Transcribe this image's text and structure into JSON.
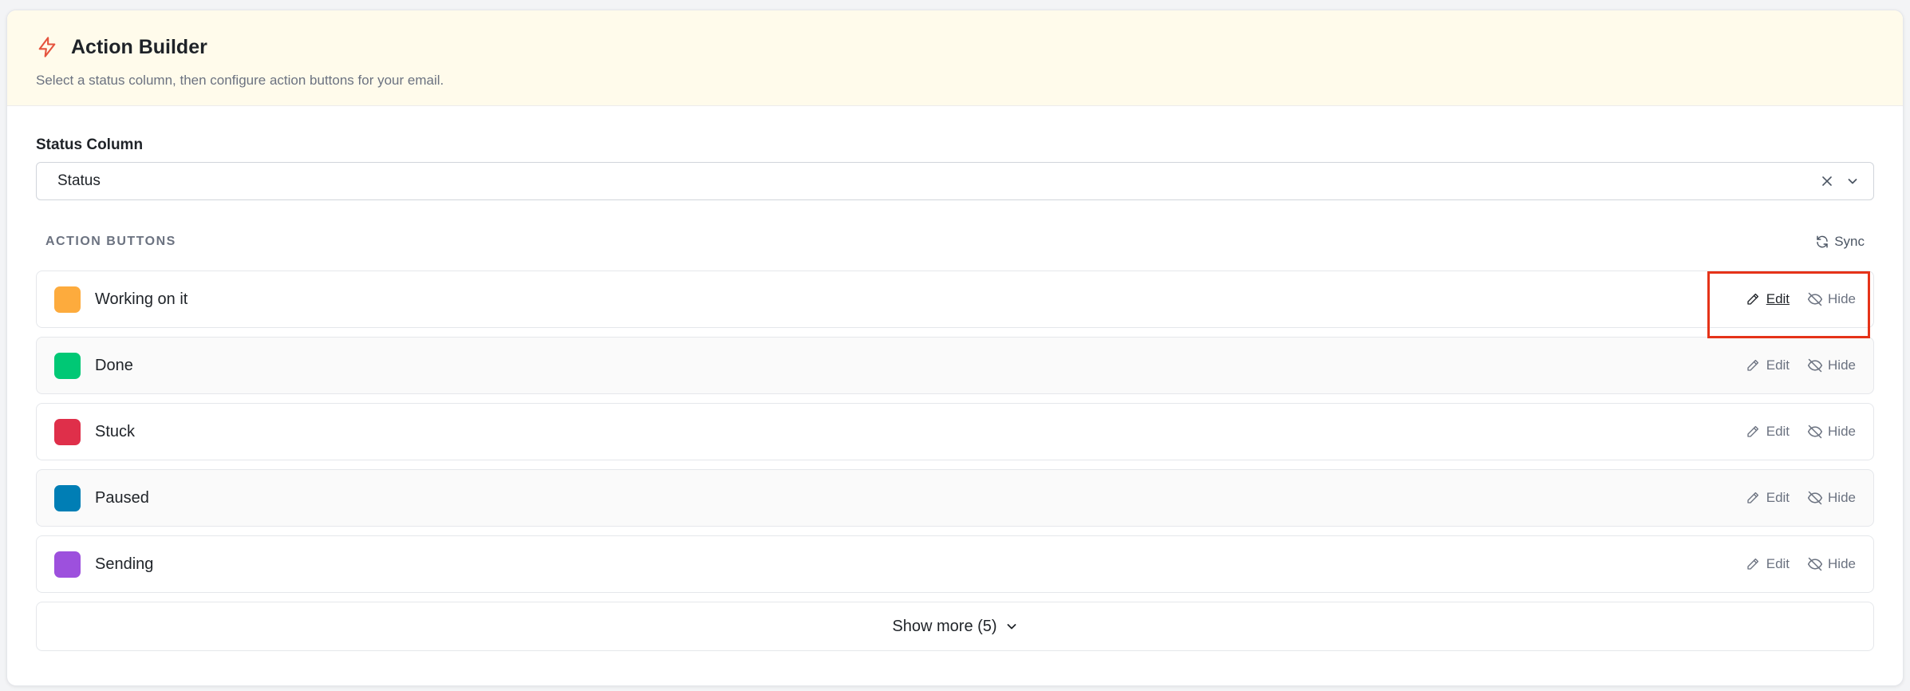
{
  "header": {
    "title": "Action Builder",
    "subtitle": "Select a status column, then configure action buttons for your email.",
    "icon": "lightning-icon",
    "icon_color": "#e5533d"
  },
  "status_column": {
    "label": "Status Column",
    "value": "Status"
  },
  "action_buttons": {
    "section_title": "ACTION BUTTONS",
    "sync_label": "Sync",
    "edit_label": "Edit",
    "hide_label": "Hide",
    "items": [
      {
        "label": "Working on it",
        "color": "#fdab3d"
      },
      {
        "label": "Done",
        "color": "#00c875"
      },
      {
        "label": "Stuck",
        "color": "#df2f4a"
      },
      {
        "label": "Paused",
        "color": "#007eb5"
      },
      {
        "label": "Sending",
        "color": "#9d50dd"
      }
    ],
    "show_more_label": "Show more (5)"
  }
}
